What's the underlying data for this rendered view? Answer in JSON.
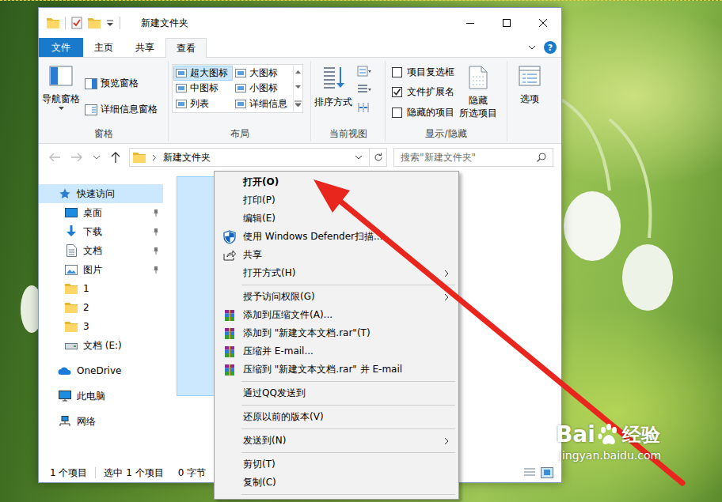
{
  "window": {
    "title": "新建文件夹",
    "help": "?"
  },
  "ribbon": {
    "file_tab": "文件",
    "tabs": [
      {
        "label": "主页",
        "selected": false
      },
      {
        "label": "共享",
        "selected": false
      },
      {
        "label": "查看",
        "selected": true
      }
    ],
    "panes": {
      "label": "窗格",
      "navigation": "导航窗格",
      "preview": "预览窗格",
      "details": "详细信息窗格"
    },
    "layout": {
      "label": "布局",
      "options": [
        {
          "label": "超大图标",
          "selected": true
        },
        {
          "label": "大图标",
          "selected": false
        },
        {
          "label": "中图标",
          "selected": false
        },
        {
          "label": "小图标",
          "selected": false
        },
        {
          "label": "列表",
          "selected": false
        },
        {
          "label": "详细信息",
          "selected": false
        }
      ]
    },
    "current_view": {
      "label": "当前视图",
      "sort": "排序方式"
    },
    "show_hide": {
      "label": "显示/隐藏",
      "checkboxes": [
        {
          "label": "项目复选框",
          "checked": false
        },
        {
          "label": "文件扩展名",
          "checked": true
        },
        {
          "label": "隐藏的项目",
          "checked": false
        }
      ],
      "hide_selected": [
        "隐藏",
        "所选项目"
      ]
    },
    "options": {
      "label": "选项"
    }
  },
  "address_bar": {
    "path": "新建文件夹",
    "search_placeholder": "搜索\"新建文件夹\""
  },
  "sidebar": {
    "items": [
      {
        "label": "快速访问",
        "selected": true,
        "pinned": false
      },
      {
        "label": "桌面",
        "selected": false,
        "pinned": true
      },
      {
        "label": "下载",
        "selected": false,
        "pinned": true
      },
      {
        "label": "文档",
        "selected": false,
        "pinned": true
      },
      {
        "label": "图片",
        "selected": false,
        "pinned": true
      },
      {
        "label": "1",
        "selected": false,
        "pinned": false
      },
      {
        "label": "2",
        "selected": false,
        "pinned": false
      },
      {
        "label": "3",
        "selected": false,
        "pinned": false
      },
      {
        "label": "文档 (E:)",
        "selected": false,
        "pinned": false
      },
      {
        "label": "OneDrive",
        "selected": false,
        "pinned": false
      },
      {
        "label": "此电脑",
        "selected": false,
        "pinned": false
      },
      {
        "label": "网络",
        "selected": false,
        "pinned": false
      }
    ]
  },
  "content": {
    "items": [
      {
        "selected": true
      }
    ]
  },
  "status_bar": {
    "count": "1 个项目",
    "selection": "选中 1 个项目",
    "size": "0 字节"
  },
  "context_menu": {
    "items": [
      {
        "kind": "item",
        "label": "打开(O)",
        "default": true,
        "submenu": false
      },
      {
        "kind": "item",
        "label": "打印(P)",
        "default": false,
        "submenu": false
      },
      {
        "kind": "item",
        "label": "编辑(E)",
        "default": false,
        "submenu": false
      },
      {
        "kind": "item",
        "label": "使用 Windows Defender扫描...",
        "default": false,
        "submenu": false
      },
      {
        "kind": "item",
        "label": "共享",
        "default": false,
        "submenu": false
      },
      {
        "kind": "item",
        "label": "打开方式(H)",
        "default": false,
        "submenu": true
      },
      {
        "kind": "separator"
      },
      {
        "kind": "item",
        "label": "授予访问权限(G)",
        "default": false,
        "submenu": true
      },
      {
        "kind": "item",
        "label": "添加到压缩文件(A)...",
        "default": false,
        "submenu": false
      },
      {
        "kind": "item",
        "label": "添加到 \"新建文本文档.rar\"(T)",
        "default": false,
        "submenu": false
      },
      {
        "kind": "item",
        "label": "压缩并 E-mail...",
        "default": false,
        "submenu": false
      },
      {
        "kind": "item",
        "label": "压缩到 \"新建文本文档.rar\" 并 E-mail",
        "default": false,
        "submenu": false
      },
      {
        "kind": "separator"
      },
      {
        "kind": "item",
        "label": "通过QQ发送到",
        "default": false,
        "submenu": false
      },
      {
        "kind": "separator"
      },
      {
        "kind": "item",
        "label": "还原以前的版本(V)",
        "default": false,
        "submenu": false
      },
      {
        "kind": "separator"
      },
      {
        "kind": "item",
        "label": "发送到(N)",
        "default": false,
        "submenu": true
      },
      {
        "kind": "separator"
      },
      {
        "kind": "item",
        "label": "剪切(T)",
        "default": false,
        "submenu": false
      },
      {
        "kind": "item",
        "label": "复制(C)",
        "default": false,
        "submenu": false
      },
      {
        "kind": "separator"
      }
    ]
  },
  "watermark": {
    "brand": "Bai",
    "brand_suffix": "经验",
    "url": "jingyan.baidu.com"
  }
}
